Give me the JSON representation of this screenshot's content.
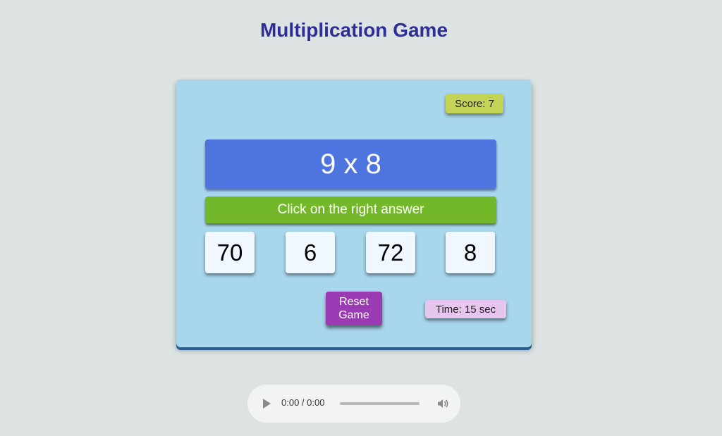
{
  "page": {
    "title": "Multiplication Game"
  },
  "game": {
    "score_label": "Score: 7",
    "score": 7,
    "question": "9 x 8",
    "instruction": "Click on the right answer",
    "choices": [
      "70",
      "6",
      "72",
      "8"
    ],
    "reset_label": "Reset Game",
    "time_label": "Time: 15 sec",
    "time_remaining_sec": 15
  },
  "audio_player": {
    "time_readout": "0:00 / 0:00",
    "progress": 0,
    "icons": {
      "play": "play-icon",
      "volume": "volume-icon"
    }
  },
  "colors": {
    "title": "#2e2e98",
    "container": "#a8d6ec",
    "score": "#c4d356",
    "question": "#4e74e0",
    "instruction": "#73b828",
    "choice": "#f0f7ff",
    "reset": "#9b3bb3",
    "time": "#e6c6ef"
  }
}
